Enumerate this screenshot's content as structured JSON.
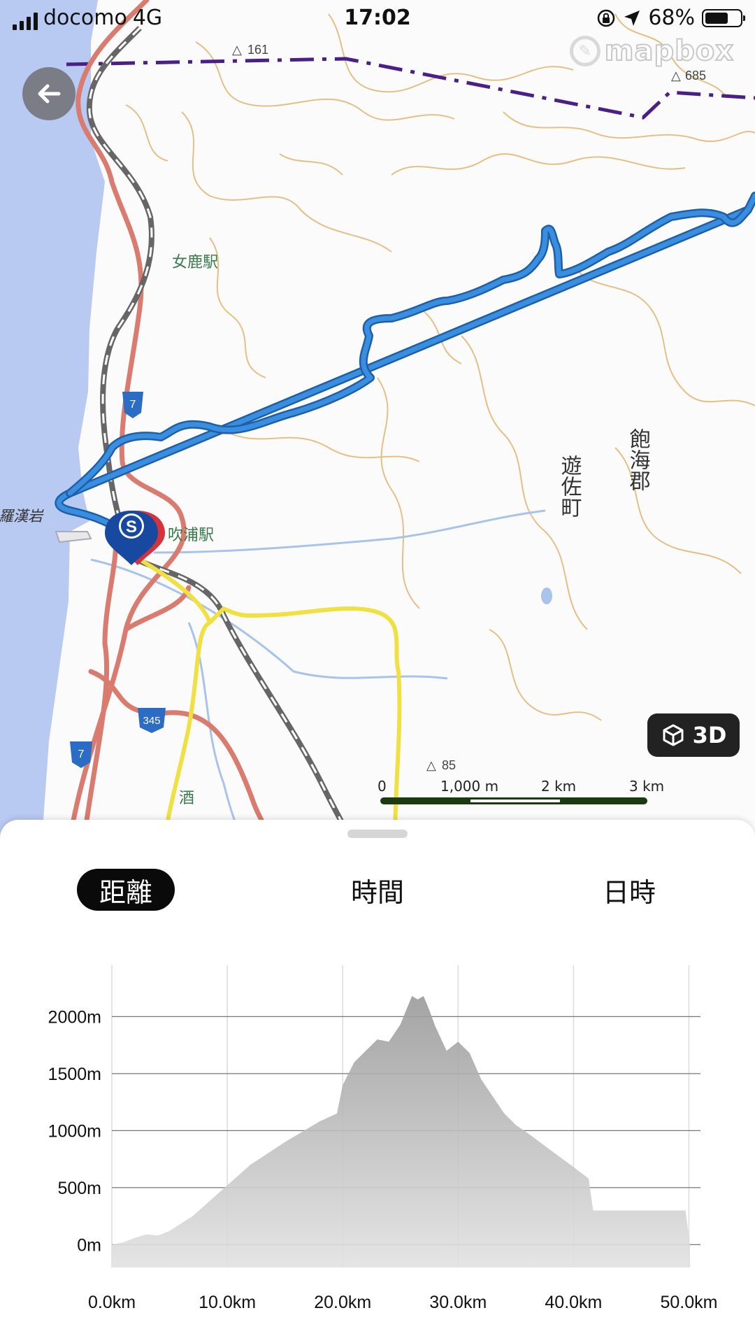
{
  "status_bar": {
    "carrier": "docomo",
    "network": "4G",
    "time": "17:02",
    "battery": "68%",
    "battery_level": 0.68
  },
  "map": {
    "attribution": "mapbox",
    "labels": {
      "station_memika": "女鹿駅",
      "station_fukura": "吹浦駅",
      "rakanji": "羅漢岩",
      "town_yuza": "遊佐町",
      "district_akumi": "飽海郡",
      "sake": "酒",
      "peak_161": "161",
      "peak_685": "685",
      "peak_85": "85",
      "route_7a": "7",
      "route_7b": "7",
      "route_345": "345"
    },
    "start_marker": "S",
    "button_3d": "3D",
    "scale": {
      "zero": "0",
      "m1000": "1,000 m",
      "km2": "2 km",
      "km3": "3 km"
    }
  },
  "sheet": {
    "tabs": [
      {
        "label": "距離",
        "active": true
      },
      {
        "label": "時間",
        "active": false
      },
      {
        "label": "日時",
        "active": false
      }
    ]
  },
  "chart_data": {
    "type": "area",
    "title": "",
    "xlabel": "",
    "ylabel": "",
    "x_unit": "km",
    "y_unit": "m",
    "xlim": [
      0,
      51
    ],
    "ylim": [
      -200,
      2450
    ],
    "x_ticks": [
      "0.0km",
      "10.0km",
      "20.0km",
      "30.0km",
      "40.0km",
      "50.0km"
    ],
    "y_ticks": [
      "0m",
      "500m",
      "1000m",
      "1500m",
      "2000m"
    ],
    "x_tick_values": [
      0,
      10,
      20,
      30,
      40,
      50
    ],
    "y_tick_values": [
      0,
      500,
      1000,
      1500,
      2000
    ],
    "grid": true,
    "series": [
      {
        "x": [
          0,
          1,
          2,
          3,
          4,
          5,
          7,
          9,
          12,
          15,
          18,
          19.5,
          20,
          21,
          22,
          23,
          24,
          25,
          26,
          26.5,
          27,
          27.5,
          28,
          29,
          30,
          31,
          32,
          33,
          34,
          35,
          36,
          38,
          40,
          41.3,
          41.7,
          49.7,
          50.1
        ],
        "y": [
          0,
          20,
          60,
          90,
          80,
          120,
          250,
          430,
          700,
          900,
          1080,
          1150,
          1400,
          1600,
          1700,
          1800,
          1780,
          1930,
          2180,
          2150,
          2180,
          2060,
          1920,
          1700,
          1780,
          1680,
          1450,
          1300,
          1150,
          1050,
          980,
          830,
          680,
          580,
          300,
          300,
          0
        ]
      }
    ]
  }
}
